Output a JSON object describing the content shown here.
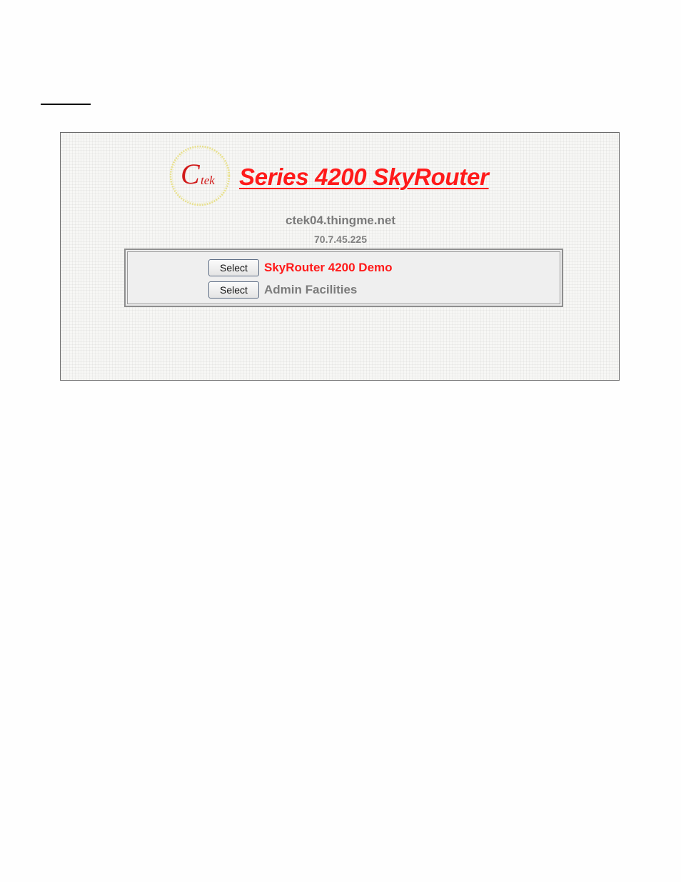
{
  "device": {
    "product_title": "Series 4200 SkyRouter",
    "hostname": "ctek04.thingme.net",
    "ip_address": "70.7.45.225"
  },
  "logo": {
    "text": "Ctek",
    "ring_color": "#e8e08a",
    "text_color": "#d01818"
  },
  "menu": {
    "items": [
      {
        "button_label": "Select",
        "label": "SkyRouter 4200 Demo",
        "color": "#ff1a1a"
      },
      {
        "button_label": "Select",
        "label": "Admin Facilities",
        "color": "#7c7c7c"
      }
    ]
  },
  "colors": {
    "accent": "#ff1a1a",
    "muted_text": "#7a7a7a"
  }
}
